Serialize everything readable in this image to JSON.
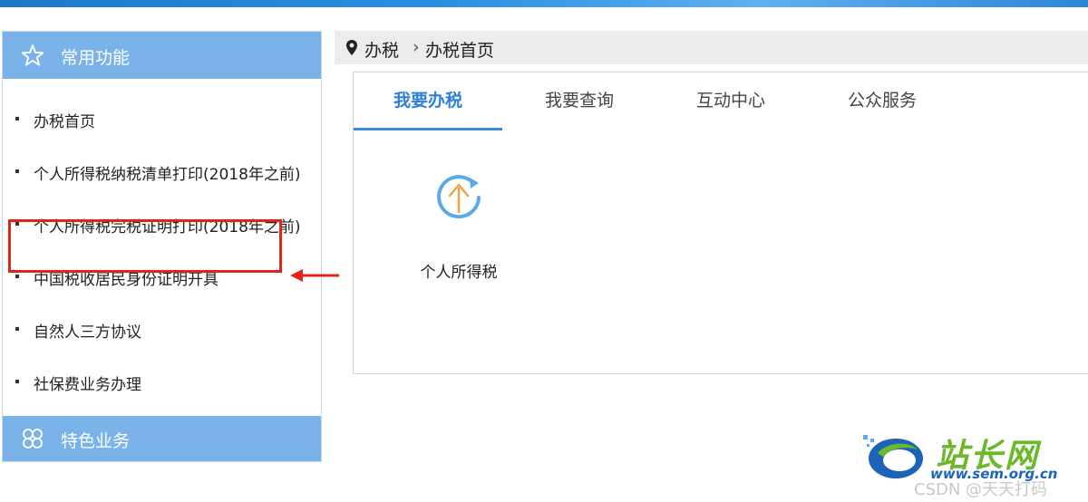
{
  "sidebar": {
    "header": {
      "label": "常用功能",
      "icon": "star-icon"
    },
    "items": [
      {
        "label": "办税首页"
      },
      {
        "label": "个人所得税纳税清单打印(2018年之前)"
      },
      {
        "label": "个人所得税完税证明打印(2018年之前)"
      },
      {
        "label": "中国税收居民身份证明开具"
      },
      {
        "label": "自然人三方协议"
      },
      {
        "label": "社保费业务办理"
      }
    ],
    "footer": {
      "label": "特色业务",
      "icon": "clover-grid-icon"
    }
  },
  "breadcrumb": {
    "root": "办税",
    "separator": "›",
    "current": "办税首页",
    "icon": "location-pin-icon"
  },
  "tabs": [
    {
      "label": "我要办税",
      "active": true
    },
    {
      "label": "我要查询",
      "active": false
    },
    {
      "label": "互动中心",
      "active": false
    },
    {
      "label": "公众服务",
      "active": false
    }
  ],
  "services": [
    {
      "label": "个人所得税",
      "icon": "individual-tax-icon"
    }
  ],
  "annotation": {
    "highlighted_item": "中国税收居民身份证明开具",
    "color": "#e2231a"
  },
  "watermark": {
    "brand": "站长网",
    "site": "www.sem.org.cn",
    "credit": "CSDN @天天打码"
  },
  "colors": {
    "accent": "#3d8be0",
    "sidebar_head": "#79b3ea",
    "annotation": "#e2231a"
  }
}
